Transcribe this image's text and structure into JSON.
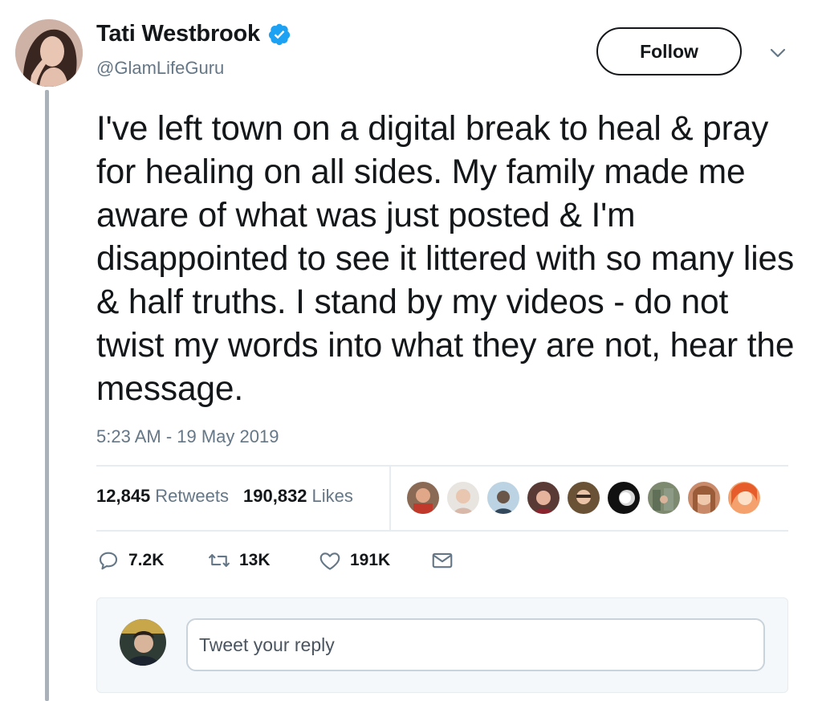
{
  "author": {
    "display_name": "Tati Westbrook",
    "handle": "@GlamLifeGuru",
    "verified": true,
    "avatar_icon": "profile-avatar"
  },
  "follow_label": "Follow",
  "tweet": {
    "text": "I've left town on a digital break to heal & pray for healing on all sides. My family made me aware of what was just posted & I'm disappointed to see it littered with so many lies & half truths. I stand by my videos - do not twist my words into what they are not, hear the message.",
    "timestamp": "5:23 AM - 19 May 2019"
  },
  "stats": {
    "retweets_count": "12,845",
    "retweets_label": "Retweets",
    "likes_count": "190,832",
    "likes_label": "Likes"
  },
  "likers_count_shown": 9,
  "actions": {
    "reply_count": "7.2K",
    "retweet_count": "13K",
    "like_count": "191K"
  },
  "reply": {
    "placeholder": "Tweet your reply"
  },
  "colors": {
    "verified_blue": "#1da1f2",
    "secondary_text": "#657786",
    "divider": "#e6ecf0"
  }
}
